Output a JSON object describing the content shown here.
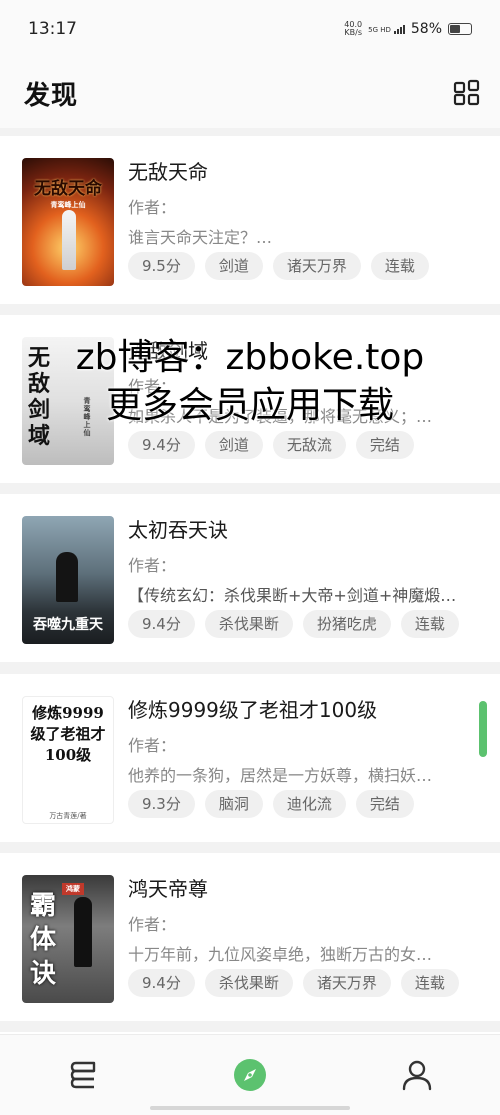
{
  "status_bar": {
    "time": "13:17",
    "net_speed_value": "40.0",
    "net_speed_unit": "KB/s",
    "network": "5G HD",
    "battery": "58%"
  },
  "header": {
    "title": "发现",
    "layout_icon": "grid-layout-icon"
  },
  "books": [
    {
      "title": "无敌天命",
      "author": "作者：",
      "description": "谁言天命天注定？…",
      "tags": [
        "9.5分",
        "剑道",
        "诸天万界",
        "连载"
      ],
      "cover_text": "无敌天命",
      "cover_sub": "青鸾峰上仙"
    },
    {
      "title": "无敌剑域",
      "author": "作者：",
      "description": "如果杀人不是为了装逼，那将毫无意义；…",
      "tags": [
        "9.4分",
        "剑道",
        "无敌流",
        "完结"
      ],
      "cover_text": "无敌剑域",
      "cover_sub": "青鸾峰上仙"
    },
    {
      "title": "太初吞天诀",
      "author": "作者：",
      "description": "【传统玄幻：杀伐果断+大帝+剑道+神魔煅…",
      "tags": [
        "9.4分",
        "杀伐果断",
        "扮猪吃虎",
        "连载"
      ],
      "cover_text": "吞噬九重天",
      "cover_sub": ""
    },
    {
      "title": "修炼9999级了老祖才100级",
      "author": "作者：",
      "description": "他养的一条狗，居然是一方妖尊，横扫妖…",
      "tags": [
        "9.3分",
        "脑洞",
        "迪化流",
        "完结"
      ],
      "cover_text": "修炼9999级了老祖才100级",
      "cover_sub": "万古青莲/著"
    },
    {
      "title": "鸿天帝尊",
      "author": "作者：",
      "description": "十万年前，九位风姿卓绝，独断万古的女…",
      "tags": [
        "9.4分",
        "杀伐果断",
        "诸天万界",
        "连载"
      ],
      "cover_text": "霸体诀",
      "cover_sub": "鸿蒙"
    }
  ],
  "watermark": {
    "line1": "zb博客：zbboke.top",
    "line2": "更多会员应用下载"
  },
  "bottom_nav": [
    {
      "name": "bookshelf",
      "icon": "bookshelf-icon",
      "active": false
    },
    {
      "name": "discover",
      "icon": "compass-icon",
      "active": true
    },
    {
      "name": "profile",
      "icon": "user-icon",
      "active": false
    }
  ],
  "colors": {
    "accent": "#5cc26f"
  }
}
